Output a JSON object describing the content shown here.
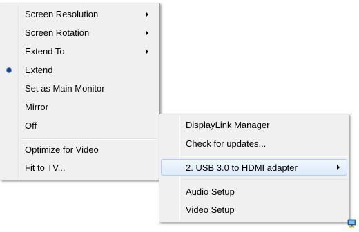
{
  "display_menu": {
    "items": [
      {
        "label": "Screen Resolution"
      },
      {
        "label": "Screen Rotation"
      },
      {
        "label": "Extend To"
      },
      {
        "label": "Extend"
      },
      {
        "label": "Set as Main Monitor"
      },
      {
        "label": "Mirror"
      },
      {
        "label": "Off"
      },
      {
        "label": "Optimize for Video"
      },
      {
        "label": "Fit to TV..."
      }
    ]
  },
  "tray_menu": {
    "items": [
      {
        "label": "DisplayLink Manager"
      },
      {
        "label": "Check for updates..."
      },
      {
        "label": "2. USB 3.0 to HDMI adapter"
      },
      {
        "label": "Audio Setup"
      },
      {
        "label": "Video Setup"
      }
    ]
  },
  "icons": {
    "submenu": "chevron-right-icon",
    "selected": "radio-dot-icon",
    "tray": "displaylink-monitor-icon"
  },
  "colors": {
    "menu_background": "#f0f0f0",
    "highlight_border": "#aecff7",
    "radio_dot": "#1d3f86"
  }
}
